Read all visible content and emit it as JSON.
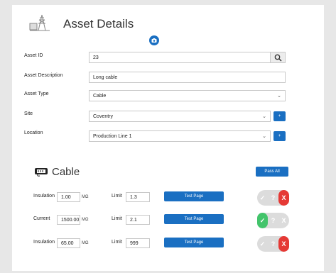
{
  "header": {
    "title": "Asset Details"
  },
  "form": {
    "asset_id": {
      "label": "Asset ID",
      "value": "23"
    },
    "asset_description": {
      "label": "Asset Description",
      "value": "Long cable"
    },
    "asset_type": {
      "label": "Asset Type",
      "value": "Cable"
    },
    "site": {
      "label": "Site",
      "value": "Coventry",
      "add": "+"
    },
    "location": {
      "label": "Location",
      "value": "Production Line 1",
      "add": "+"
    }
  },
  "section": {
    "title": "Cable",
    "pass_all_label": "Pass All"
  },
  "tests": [
    {
      "name": "Insulation",
      "value": "1.00",
      "unit": "MΩ",
      "limit_label": "Limit",
      "limit": "1.3",
      "button": "Test Page",
      "status": "fail"
    },
    {
      "name": "Current",
      "value": "1500.00",
      "unit": "MΩ",
      "limit_label": "Limit",
      "limit": "2.1",
      "button": "Test Page",
      "status": "pass"
    },
    {
      "name": "Insulation",
      "value": "65.00",
      "unit": "MΩ",
      "limit_label": "Limit",
      "limit": "999",
      "button": "Test Page",
      "status": "fail"
    }
  ],
  "toggle_symbols": {
    "pass": "✓",
    "unknown": "?",
    "fail": "X"
  },
  "colors": {
    "accent": "#1a6fc2",
    "pass": "#43c46b",
    "fail": "#e53935",
    "toggle_bg": "#dcdcdc"
  },
  "icons": {
    "asset_icon": "power-pylon-icon",
    "camera_icon": "camera-icon",
    "search_icon": "magnifier-icon",
    "cable_icon": "cable-connector-icon"
  }
}
